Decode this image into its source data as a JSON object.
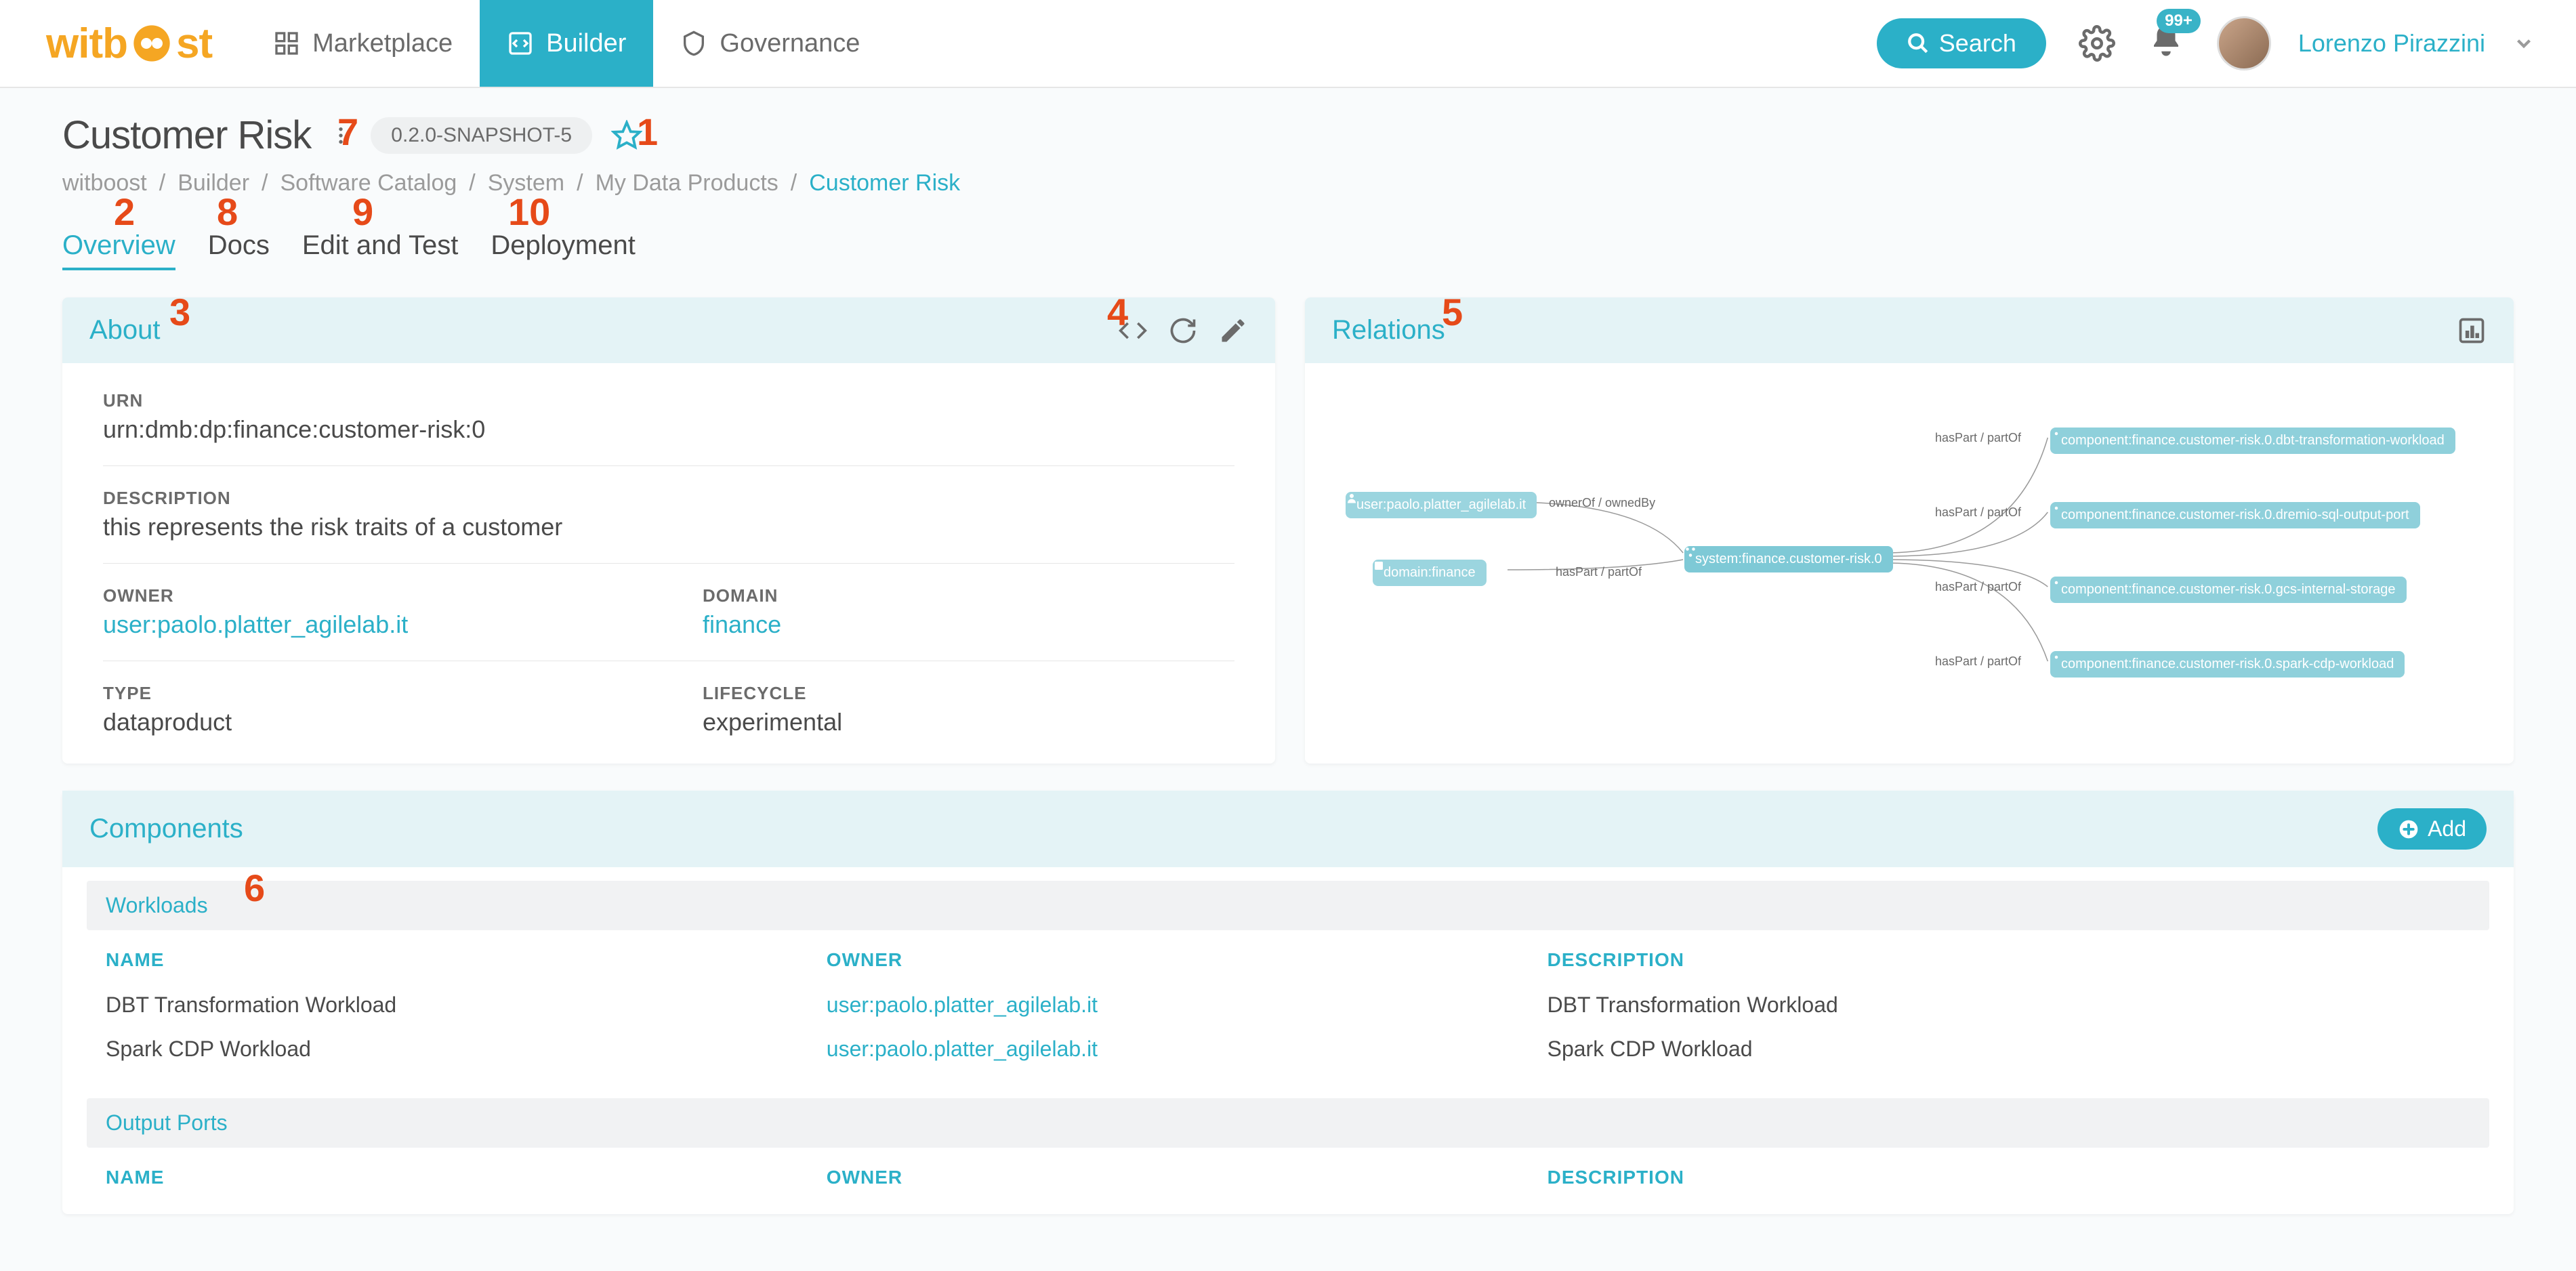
{
  "topnav": {
    "logo_text": "witboost",
    "items": [
      {
        "label": "Marketplace",
        "icon": "grid-icon",
        "active": false
      },
      {
        "label": "Builder",
        "icon": "builder-icon",
        "active": true
      },
      {
        "label": "Governance",
        "icon": "shield-icon",
        "active": false
      }
    ],
    "search_label": "Search",
    "notif_badge": "99+",
    "user_name": "Lorenzo Pirazzini"
  },
  "page_title": "Customer Risk",
  "version_chip": "0.2.0-SNAPSHOT-5",
  "breadcrumbs": [
    "witboost",
    "Builder",
    "Software Catalog",
    "System",
    "My Data Products",
    "Customer Risk"
  ],
  "tabs": [
    "Overview",
    "Docs",
    "Edit and Test",
    "Deployment"
  ],
  "active_tab": "Overview",
  "about": {
    "title": "About",
    "urn_label": "URN",
    "urn_value": "urn:dmb:dp:finance:customer-risk:0",
    "desc_label": "DESCRIPTION",
    "desc_value": "this represents the risk traits of a customer",
    "owner_label": "OWNER",
    "owner_value": "user:paolo.platter_agilelab.it",
    "domain_label": "DOMAIN",
    "domain_value": "finance",
    "type_label": "TYPE",
    "type_value": "dataproduct",
    "lifecycle_label": "LIFECYCLE",
    "lifecycle_value": "experimental"
  },
  "relations": {
    "title": "Relations",
    "center_node": "system:finance.customer-risk.0",
    "left_nodes": [
      {
        "label": "user:paolo.platter_agilelab.it",
        "edge": "ownerOf / ownedBy"
      },
      {
        "label": "domain:finance",
        "edge": "hasPart / partOf"
      }
    ],
    "right_nodes": [
      {
        "label": "component:finance.customer-risk.0.dbt-transformation-workload",
        "edge": "hasPart / partOf"
      },
      {
        "label": "component:finance.customer-risk.0.dremio-sql-output-port",
        "edge": "hasPart / partOf"
      },
      {
        "label": "component:finance.customer-risk.0.gcs-internal-storage",
        "edge": "hasPart / partOf"
      },
      {
        "label": "component:finance.customer-risk.0.spark-cdp-workload",
        "edge": "hasPart / partOf"
      }
    ]
  },
  "components": {
    "title": "Components",
    "add_label": "Add",
    "sections": [
      {
        "title": "Workloads",
        "columns": [
          "NAME",
          "OWNER",
          "DESCRIPTION"
        ],
        "rows": [
          {
            "name": "DBT Transformation Workload",
            "owner": "user:paolo.platter_agilelab.it",
            "desc": "DBT Transformation Workload"
          },
          {
            "name": "Spark CDP Workload",
            "owner": "user:paolo.platter_agilelab.it",
            "desc": "Spark CDP Workload"
          }
        ]
      },
      {
        "title": "Output Ports",
        "columns": [
          "NAME",
          "OWNER",
          "DESCRIPTION"
        ],
        "rows": []
      }
    ]
  },
  "annotations": {
    "n1": "1",
    "n2": "2",
    "n3": "3",
    "n4": "4",
    "n5": "5",
    "n6": "6",
    "n7": "7",
    "n8": "8",
    "n9": "9",
    "n10": "10"
  }
}
